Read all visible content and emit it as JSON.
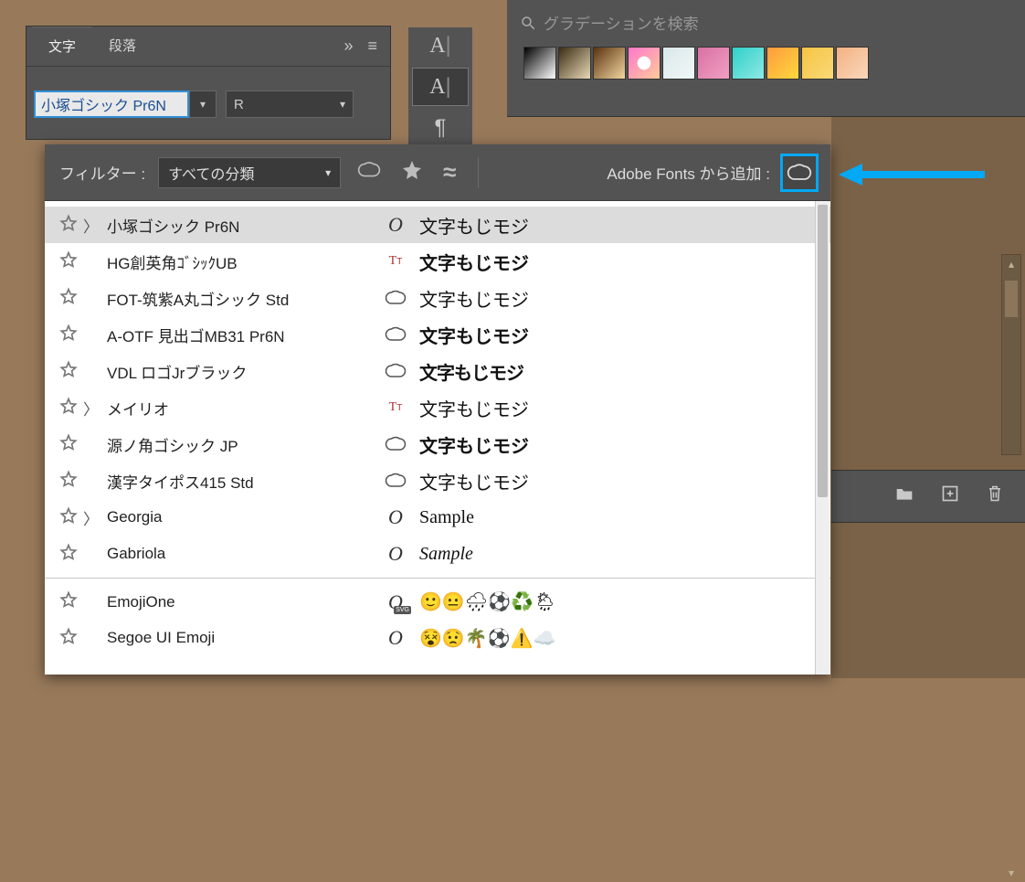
{
  "char_panel": {
    "tab_character": "文字",
    "tab_paragraph": "段落",
    "font_value": "小塚ゴシック Pr6N",
    "style_value": "R"
  },
  "grad_panel": {
    "search_placeholder": "グラデーションを検索"
  },
  "font_dropdown": {
    "filter_label": "フィルター :",
    "filter_value": "すべての分類",
    "add_label": "Adobe Fonts から追加 :",
    "rows": [
      {
        "name": "小塚ゴシック Pr6N",
        "type": "O",
        "sample": "文字もじモジ",
        "has_sub": true,
        "sel": true,
        "bold": false
      },
      {
        "name": "HG創英角ｺﾞｼｯｸUB",
        "type": "Tr",
        "sample": "文字もじモジ",
        "has_sub": false,
        "sel": false,
        "bold": true
      },
      {
        "name": "FOT-筑紫A丸ゴシック Std",
        "type": "cc",
        "sample": "文字もじモジ",
        "has_sub": false,
        "sel": false,
        "bold": false
      },
      {
        "name": "A-OTF 見出ゴMB31 Pr6N",
        "type": "cc",
        "sample": "文字もじモジ",
        "has_sub": false,
        "sel": false,
        "bold": true
      },
      {
        "name": "VDL ロゴJrブラック",
        "type": "cc",
        "sample": "文字もじモジ",
        "has_sub": false,
        "sel": false,
        "bold": true,
        "heavy": true
      },
      {
        "name": "メイリオ",
        "type": "Tr",
        "sample": "文字もじモジ",
        "has_sub": true,
        "sel": false,
        "bold": false
      },
      {
        "name": "源ノ角ゴシック JP",
        "type": "cc",
        "sample": "文字もじモジ",
        "has_sub": false,
        "sel": false,
        "bold": true
      },
      {
        "name": "漢字タイポス415 Std",
        "type": "cc",
        "sample": "文字もじモジ",
        "has_sub": false,
        "sel": false,
        "bold": false
      },
      {
        "name": "Georgia",
        "type": "O",
        "sample": "Sample",
        "has_sub": true,
        "sel": false,
        "bold": false,
        "serif": true
      },
      {
        "name": "Gabriola",
        "type": "O",
        "sample": "Sample",
        "has_sub": false,
        "sel": false,
        "bold": false,
        "script": true
      }
    ],
    "rows2": [
      {
        "name": "EmojiOne",
        "type": "svg",
        "sample": "🙂😐🌧⚽♻️🌦",
        "has_sub": false
      },
      {
        "name": "Segoe UI Emoji",
        "type": "O",
        "sample": "😵😟🌴⚽⚠️☁️",
        "has_sub": false
      }
    ]
  },
  "icons": {
    "star": "star-icon",
    "approx": "approx-icon",
    "cc": "creative-cloud-icon"
  },
  "gradient_colors": [
    "linear-gradient(135deg,#000,#fff)",
    "linear-gradient(135deg,#3a2c14,#e8d9b6)",
    "linear-gradient(135deg,#5a3210,#f3d6a0)",
    "radial-gradient(circle,#fff 30%,#fff0 31%),linear-gradient(135deg,#f7c,#fc9)",
    "linear-gradient(135deg,#d9e8ea,#f1f7f8)",
    "linear-gradient(135deg,#d971a3,#f19fc3)",
    "linear-gradient(135deg,#2fd0c9,#8fe9e4)",
    "linear-gradient(135deg,#ff9a3d,#ffd93d)",
    "linear-gradient(135deg,#f6c444,#f9d977)",
    "linear-gradient(135deg,#f3b181,#f9d7bd)"
  ]
}
